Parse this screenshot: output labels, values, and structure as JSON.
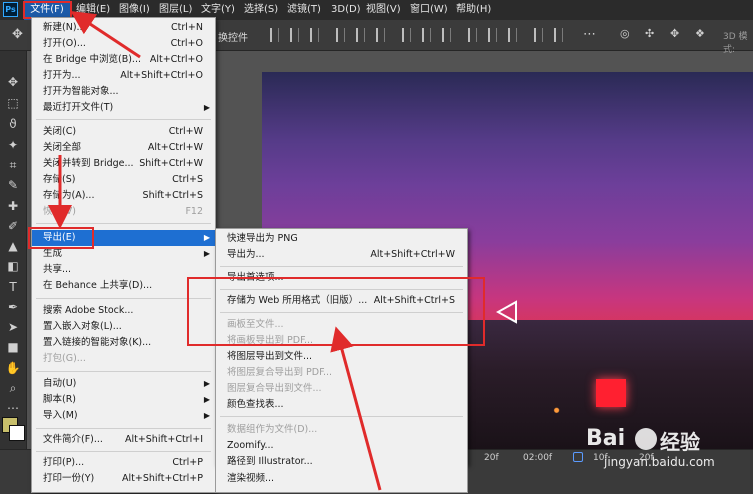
{
  "app": {
    "logo": "Ps"
  },
  "menubar": {
    "items": [
      "文件(F)",
      "编辑(E)",
      "图像(I)",
      "图层(L)",
      "文字(Y)",
      "选择(S)",
      "滤镜(T)",
      "3D(D)",
      "视图(V)",
      "窗口(W)",
      "帮助(H)"
    ],
    "active_index": 0
  },
  "optionsbar": {
    "partial_label": "换控件",
    "mode_3d_label": "3D 模式:"
  },
  "file_menu": {
    "items": [
      {
        "label": "新建(N)...",
        "shortcut": "Ctrl+N",
        "disabled": false
      },
      {
        "label": "打开(O)...",
        "shortcut": "Ctrl+O",
        "disabled": false
      },
      {
        "label": "在 Bridge 中浏览(B)...",
        "shortcut": "Alt+Ctrl+O",
        "disabled": false
      },
      {
        "label": "打开为...",
        "shortcut": "Alt+Shift+Ctrl+O",
        "disabled": false
      },
      {
        "label": "打开为智能对象...",
        "shortcut": "",
        "disabled": false
      },
      {
        "label": "最近打开文件(T)",
        "shortcut": "",
        "disabled": false,
        "submenu": true
      },
      {
        "label": "关闭(C)",
        "shortcut": "Ctrl+W",
        "disabled": false
      },
      {
        "label": "关闭全部",
        "shortcut": "Alt+Ctrl+W",
        "disabled": false
      },
      {
        "label": "关闭并转到 Bridge...",
        "shortcut": "Shift+Ctrl+W",
        "disabled": false
      },
      {
        "label": "存储(S)",
        "shortcut": "Ctrl+S",
        "disabled": false
      },
      {
        "label": "存储为(A)...",
        "shortcut": "Shift+Ctrl+S",
        "disabled": false
      },
      {
        "label": "恢复(V)",
        "shortcut": "F12",
        "disabled": true
      },
      {
        "label": "导出(E)",
        "shortcut": "",
        "disabled": false,
        "submenu": true,
        "selected": true
      },
      {
        "label": "生成",
        "shortcut": "",
        "disabled": false,
        "submenu": true
      },
      {
        "label": "共享...",
        "shortcut": "",
        "disabled": false
      },
      {
        "label": "在 Behance 上共享(D)...",
        "shortcut": "",
        "disabled": false
      },
      {
        "label": "搜索 Adobe Stock...",
        "shortcut": "",
        "disabled": false
      },
      {
        "label": "置入嵌入对象(L)...",
        "shortcut": "",
        "disabled": false
      },
      {
        "label": "置入链接的智能对象(K)...",
        "shortcut": "",
        "disabled": false
      },
      {
        "label": "打包(G)...",
        "shortcut": "",
        "disabled": true
      },
      {
        "label": "自动(U)",
        "shortcut": "",
        "disabled": false,
        "submenu": true
      },
      {
        "label": "脚本(R)",
        "shortcut": "",
        "disabled": false,
        "submenu": true
      },
      {
        "label": "导入(M)",
        "shortcut": "",
        "disabled": false,
        "submenu": true
      },
      {
        "label": "文件简介(F)...",
        "shortcut": "Alt+Shift+Ctrl+I",
        "disabled": false
      },
      {
        "label": "打印(P)...",
        "shortcut": "Ctrl+P",
        "disabled": false
      },
      {
        "label": "打印一份(Y)",
        "shortcut": "Alt+Shift+Ctrl+P",
        "disabled": false
      }
    ]
  },
  "export_menu": {
    "items": [
      {
        "label": "快速导出为 PNG",
        "shortcut": "",
        "disabled": false
      },
      {
        "label": "导出为...",
        "shortcut": "Alt+Shift+Ctrl+W",
        "disabled": false
      },
      {
        "label": "导出首选项...",
        "shortcut": "",
        "disabled": false
      },
      {
        "label": "存储为 Web 所用格式（旧版）...",
        "shortcut": "Alt+Shift+Ctrl+S",
        "disabled": false
      },
      {
        "label": "画板至文件...",
        "shortcut": "",
        "disabled": true
      },
      {
        "label": "将画板导出到 PDF...",
        "shortcut": "",
        "disabled": true
      },
      {
        "label": "将图层导出到文件...",
        "shortcut": "",
        "disabled": false
      },
      {
        "label": "将图层复合导出到 PDF...",
        "shortcut": "",
        "disabled": true
      },
      {
        "label": "图层复合导出到文件...",
        "shortcut": "",
        "disabled": true
      },
      {
        "label": "颜色查找表...",
        "shortcut": "",
        "disabled": false
      },
      {
        "label": "数据组作为文件(D)...",
        "shortcut": "",
        "disabled": true
      },
      {
        "label": "Zoomify...",
        "shortcut": "",
        "disabled": false
      },
      {
        "label": "路径到 Illustrator...",
        "shortcut": "",
        "disabled": false
      },
      {
        "label": "渲染视频...",
        "shortcut": "",
        "disabled": false
      }
    ]
  },
  "timeline": {
    "labels": [
      "20f",
      "02:00f",
      "10f",
      "20f"
    ]
  },
  "watermark": {
    "brand_a": "Bai",
    "brand_b": "经验",
    "site": "jingyan.baidu.com"
  },
  "colors": {
    "highlight": "#1e6fd2",
    "annotation": "#e02b2b",
    "foreground": "#c8bf6b",
    "background": "#ffffff"
  }
}
